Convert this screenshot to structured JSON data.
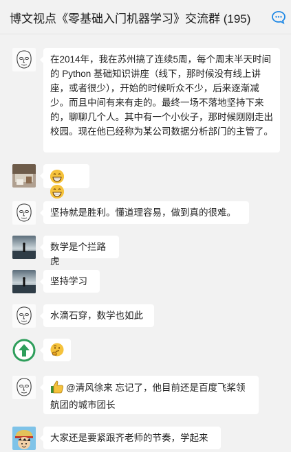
{
  "header": {
    "title": "博文视点《零基础入门机器学习》交流群 (195)",
    "chat_icon": "chat-bubble-icon"
  },
  "messages": [
    {
      "avatar": "sketch-face-avatar",
      "text": "在2014年，我在苏州搞了连续5周，每个周末半天时间的 Python 基础知识讲座（线下，那时候没有线上讲座，或者很少），开始的时候听众不少，后来逐渐减少。而且中间有来有走的。最终一场不落地坚持下来的，聊聊几个人。其中有一个小伙子，那时候刚刚走出校园。现在他已经称为某公司数据分析部门的主管了。"
    },
    {
      "avatar": "desk-photo-avatar",
      "text": "",
      "emoji": [
        "grinning-face-emoji",
        "grinning-face-emoji"
      ]
    },
    {
      "avatar": "sketch-face-avatar",
      "text": "坚持就是胜利。懂道理容易，做到真的很难。"
    },
    {
      "avatar": "sunset-figure-avatar",
      "text": "数学是个拦路虎"
    },
    {
      "avatar": "sunset-figure-avatar",
      "text": "坚持学习"
    },
    {
      "avatar": "sketch-face-avatar",
      "text": "水滴石穿，数学也如此"
    },
    {
      "avatar": "green-up-arrow-avatar",
      "text": "",
      "emoji": [
        "thinking-face-emoji"
      ]
    },
    {
      "avatar": "sketch-face-avatar",
      "text": "@清风徐来 忘记了，他目前还是百度飞桨领航团的城市团长",
      "emoji": [
        "thumbs-up-emoji"
      ]
    },
    {
      "avatar": "anime-character-avatar",
      "text": "大家还是要紧跟齐老师的节奏，学起来"
    }
  ],
  "colors": {
    "background": "#f2f2f2",
    "bubble": "#ffffff",
    "accent_blue": "#1e88e5",
    "arrow_green": "#2e9e5b"
  }
}
